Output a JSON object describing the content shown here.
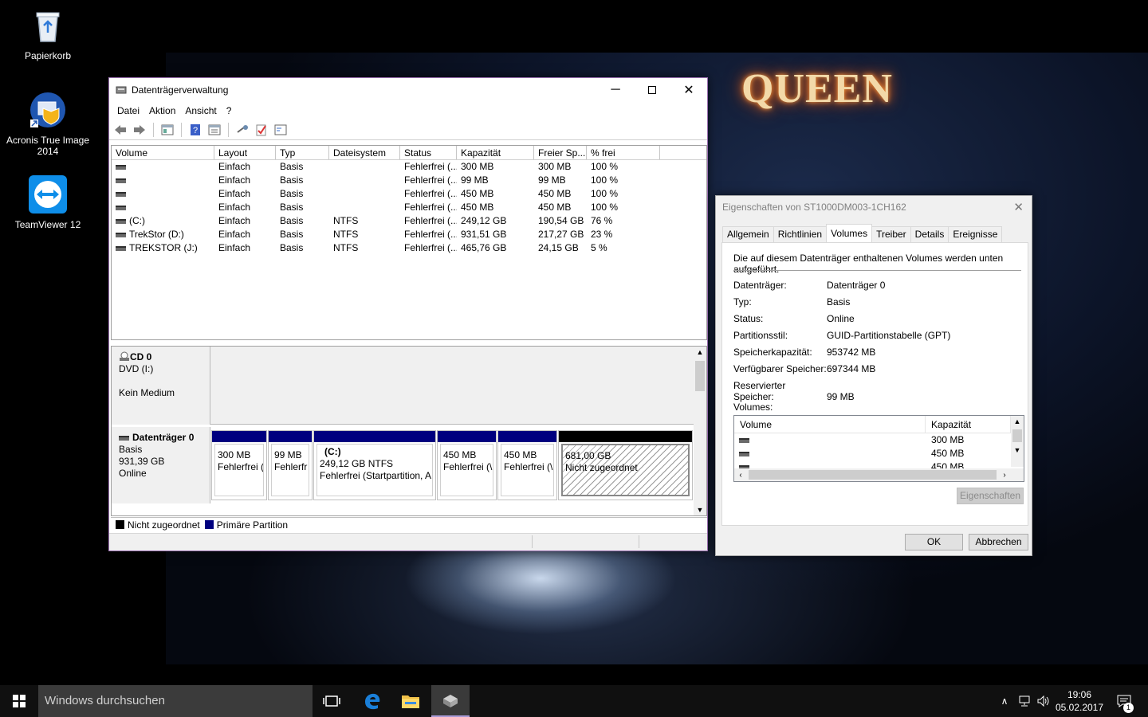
{
  "desktop": {
    "icons": [
      {
        "label": "Papierkorb"
      },
      {
        "label": "Acronis True Image 2014"
      },
      {
        "label": "TeamViewer 12"
      }
    ],
    "wallpaper_logo": "QUEEN"
  },
  "diskmgmt": {
    "title": "Datenträgerverwaltung",
    "menu": [
      "Datei",
      "Aktion",
      "Ansicht",
      "?"
    ],
    "columns": [
      "Volume",
      "Layout",
      "Typ",
      "Dateisystem",
      "Status",
      "Kapazität",
      "Freier Sp...",
      "% frei"
    ],
    "rows": [
      [
        "",
        "Einfach",
        "Basis",
        "",
        "Fehlerfrei (...",
        "300 MB",
        "300 MB",
        "100 %"
      ],
      [
        "",
        "Einfach",
        "Basis",
        "",
        "Fehlerfrei (...",
        "99 MB",
        "99 MB",
        "100 %"
      ],
      [
        "",
        "Einfach",
        "Basis",
        "",
        "Fehlerfrei (...",
        "450 MB",
        "450 MB",
        "100 %"
      ],
      [
        "",
        "Einfach",
        "Basis",
        "",
        "Fehlerfrei (...",
        "450 MB",
        "450 MB",
        "100 %"
      ],
      [
        "(C:)",
        "Einfach",
        "Basis",
        "NTFS",
        "Fehlerfrei (...",
        "249,12 GB",
        "190,54 GB",
        "76 %"
      ],
      [
        "TrekStor (D:)",
        "Einfach",
        "Basis",
        "NTFS",
        "Fehlerfrei (...",
        "931,51 GB",
        "217,27 GB",
        "23 %"
      ],
      [
        "TREKSTOR (J:)",
        "Einfach",
        "Basis",
        "NTFS",
        "Fehlerfrei (...",
        "465,76 GB",
        "24,15 GB",
        "5 %"
      ]
    ],
    "cd": {
      "name": "CD 0",
      "type": "DVD (I:)",
      "status": "Kein Medium"
    },
    "disk0": {
      "name": "Datenträger 0",
      "type": "Basis",
      "size": "931,39 GB",
      "status": "Online",
      "partitions": [
        {
          "label": "",
          "size": "300 MB",
          "status": "Fehlerfrei ("
        },
        {
          "label": "",
          "size": "99 MB",
          "status": "Fehlerfr"
        },
        {
          "label": "(C:)",
          "size": "249,12 GB NTFS",
          "status": "Fehlerfrei (Startpartition, A"
        },
        {
          "label": "",
          "size": "450 MB",
          "status": "Fehlerfrei (\\"
        },
        {
          "label": "",
          "size": "450 MB",
          "status": "Fehlerfrei (\\"
        },
        {
          "label": "",
          "size": "681,00 GB",
          "status": "Nicht zugeordnet"
        }
      ]
    },
    "legend": {
      "unallocated": "Nicht zugeordnet",
      "primary": "Primäre Partition"
    },
    "colors": {
      "primary": "#00007f",
      "unallocated": "#000000"
    }
  },
  "props": {
    "title": "Eigenschaften von ST1000DM003-1CH162",
    "tabs": [
      "Allgemein",
      "Richtlinien",
      "Volumes",
      "Treiber",
      "Details",
      "Ereignisse"
    ],
    "active_tab": "Volumes",
    "description": "Die auf diesem Datenträger enthaltenen Volumes werden unten aufgeführt.",
    "fields": [
      {
        "k": "Datenträger:",
        "v": "Datenträger 0"
      },
      {
        "k": "Typ:",
        "v": "Basis"
      },
      {
        "k": "Status:",
        "v": "Online"
      },
      {
        "k": "Partitionsstil:",
        "v": "GUID-Partitionstabelle (GPT)"
      },
      {
        "k": "Speicherkapazität:",
        "v": "953742 MB"
      },
      {
        "k": "Verfügbarer Speicher:",
        "v": "697344 MB"
      },
      {
        "k": "Reservierter Speicher:",
        "v": "99 MB"
      }
    ],
    "volumes_label": "Volumes:",
    "vol_columns": [
      "Volume",
      "Kapazität"
    ],
    "vol_rows": [
      {
        "volume": "",
        "capacity": "300 MB"
      },
      {
        "volume": "",
        "capacity": "450 MB"
      },
      {
        "volume": "",
        "capacity": "450 MB"
      }
    ],
    "properties_button": "Eigenschaften",
    "ok_button": "OK",
    "cancel_button": "Abbrechen"
  },
  "taskbar": {
    "search_placeholder": "Windows durchsuchen",
    "time": "19:06",
    "date": "05.02.2017",
    "notification_count": "1"
  }
}
